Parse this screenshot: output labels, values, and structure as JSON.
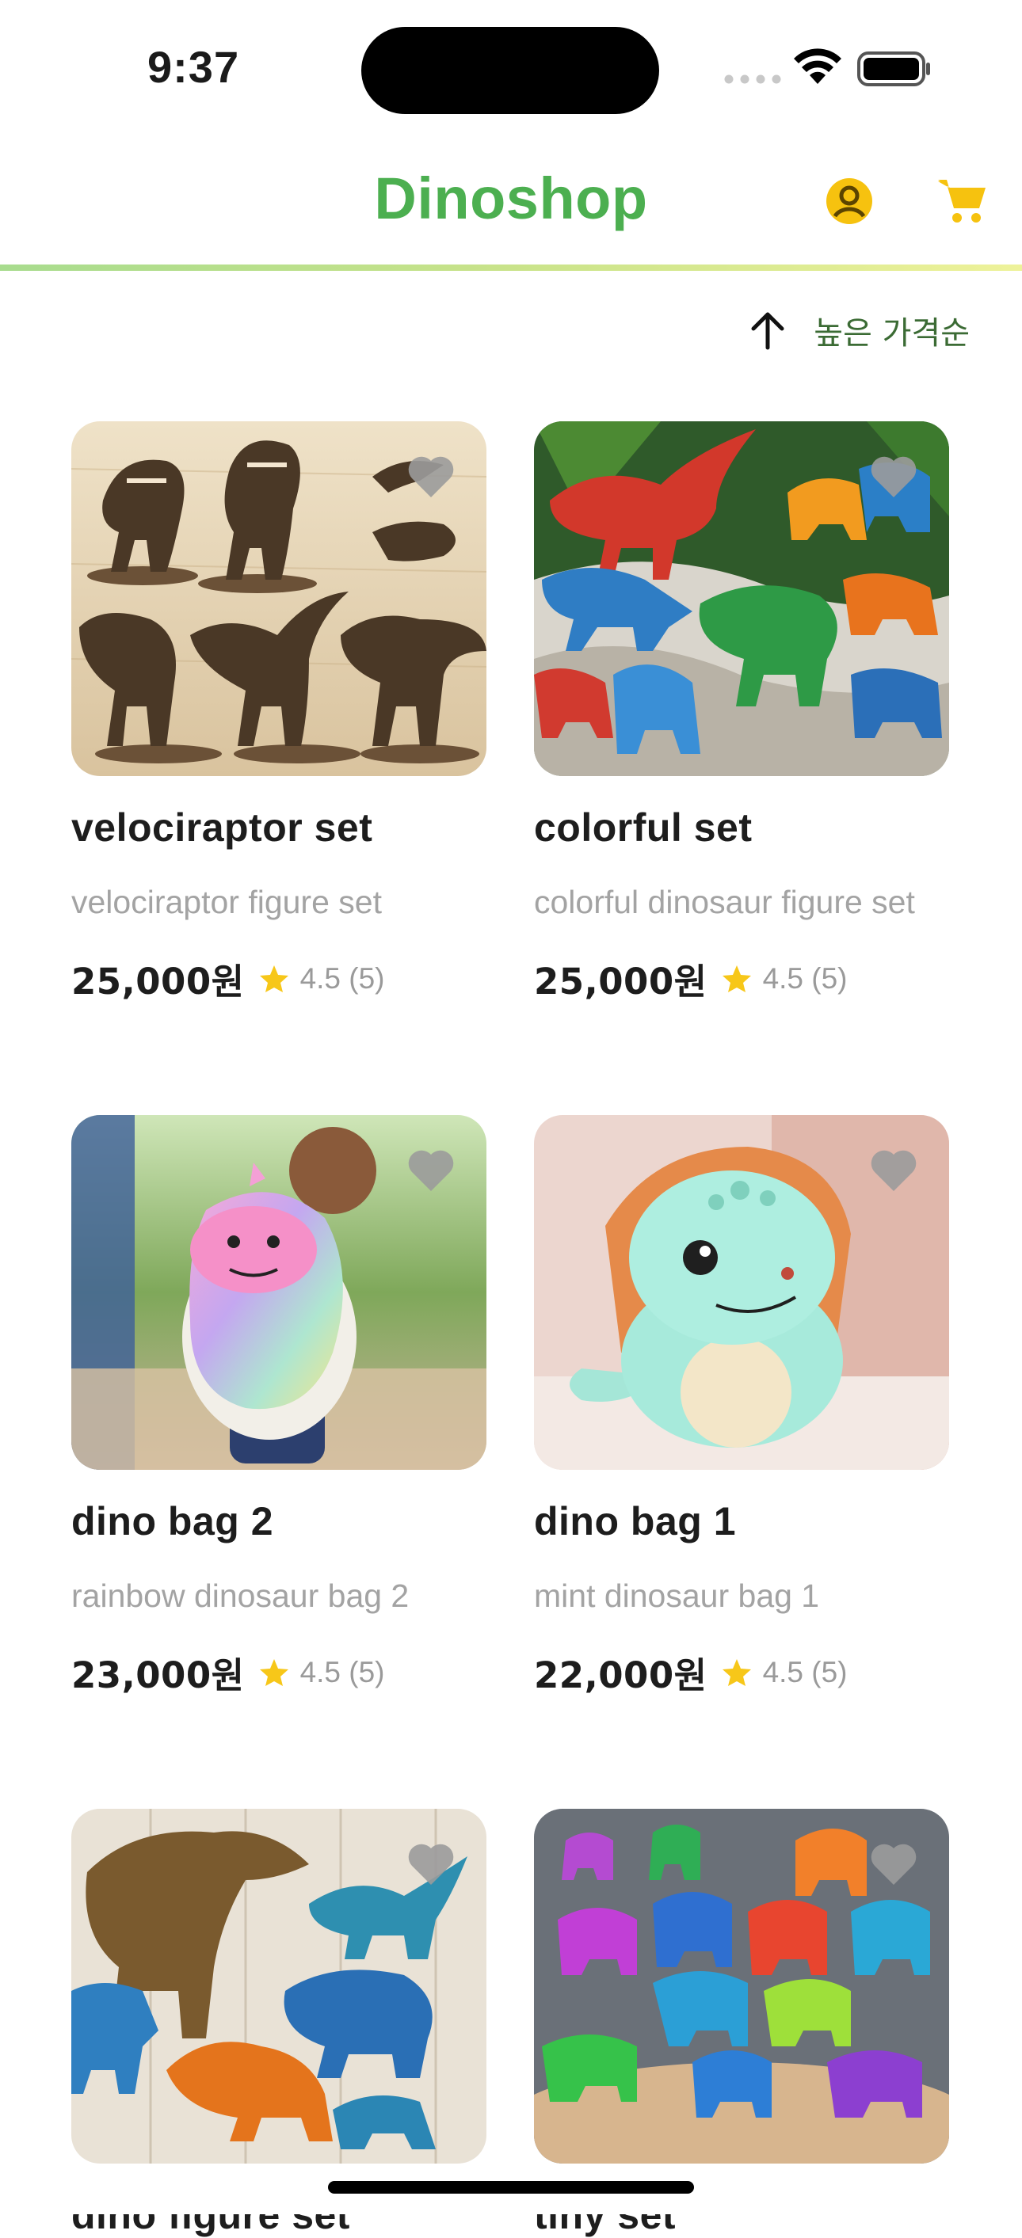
{
  "status_bar": {
    "time": "9:37"
  },
  "header": {
    "title": "Dinoshop",
    "profile_icon": "user-circle-icon",
    "cart_icon": "cart-icon",
    "accent_color": "#4caf50"
  },
  "sort": {
    "label": "높은 가격순",
    "icon": "arrow-up-icon"
  },
  "products": [
    {
      "name": "velociraptor set",
      "description": "velociraptor figure set",
      "price": "25,000원",
      "rating": "4.5 (5)"
    },
    {
      "name": "colorful set",
      "description": "colorful dinosaur figure set",
      "price": "25,000원",
      "rating": "4.5 (5)"
    },
    {
      "name": "dino bag 2",
      "description": "rainbow dinosaur bag 2",
      "price": "23,000원",
      "rating": "4.5 (5)"
    },
    {
      "name": "dino bag 1",
      "description": "mint dinosaur bag 1",
      "price": "22,000원",
      "rating": "4.5 (5)"
    },
    {
      "name": "dino figure set",
      "description": "",
      "price": "",
      "rating": ""
    },
    {
      "name": "tiny set",
      "description": "",
      "price": "",
      "rating": ""
    }
  ],
  "colors": {
    "star": "#f7c719",
    "heart": "#9b9b9b",
    "sort_text": "#3b6b34"
  }
}
